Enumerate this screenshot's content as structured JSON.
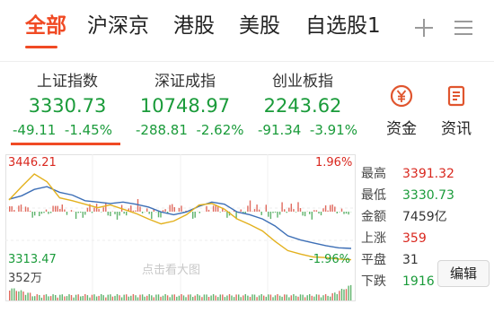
{
  "tabs": [
    {
      "label": "全部",
      "active": true
    },
    {
      "label": "沪深京",
      "active": false
    },
    {
      "label": "港股",
      "active": false
    },
    {
      "label": "美股",
      "active": false
    },
    {
      "label": "自选股1",
      "active": false
    }
  ],
  "toolbar": {
    "add_icon": "plus-icon",
    "menu_icon": "menu-icon"
  },
  "indices": [
    {
      "name": "上证指数",
      "value": "3330.73",
      "change": "-49.11",
      "pct": "-1.45%"
    },
    {
      "name": "深证成指",
      "value": "10748.97",
      "change": "-288.81",
      "pct": "-2.62%"
    },
    {
      "name": "创业板指",
      "value": "2243.62",
      "change": "-91.34",
      "pct": "-3.91%"
    }
  ],
  "side_buttons": [
    {
      "label": "资金",
      "icon": "yen-icon"
    },
    {
      "label": "资讯",
      "icon": "news-icon"
    }
  ],
  "chart": {
    "high_label": "3446.21",
    "low_label": "3313.47",
    "high_pct": "1.96%",
    "low_pct": "-1.96%",
    "volume_label": "352万",
    "watermark": "点击看大图"
  },
  "chart_data": {
    "type": "line",
    "ylim": [
      3313.47,
      3446.21
    ],
    "series": [
      {
        "color": "#3d6fb6",
        "values": [
          3400,
          3405,
          3414,
          3418,
          3410,
          3406,
          3398,
          3396,
          3394,
          3396,
          3393,
          3389,
          3382,
          3378,
          3382,
          3390,
          3396,
          3393,
          3382,
          3378,
          3372,
          3362,
          3348,
          3342,
          3338,
          3334,
          3331,
          3330
        ]
      },
      {
        "color": "#e3b11e",
        "values": [
          3399,
          3418,
          3436,
          3425,
          3402,
          3398,
          3393,
          3388,
          3392,
          3386,
          3380,
          3372,
          3365,
          3369,
          3378,
          3392,
          3394,
          3386,
          3372,
          3364,
          3355,
          3340,
          3327,
          3322,
          3318,
          3317,
          3315,
          3314
        ]
      }
    ]
  },
  "stats": [
    {
      "label": "最高",
      "value": "3391.32",
      "color": "#d9271e"
    },
    {
      "label": "最低",
      "value": "3330.73",
      "color": "#1a9b3a"
    },
    {
      "label": "金额",
      "value": "7459亿",
      "color": "#333333"
    },
    {
      "label": "上涨",
      "value": "359",
      "color": "#d9271e"
    },
    {
      "label": "平盘",
      "value": "31",
      "color": "#333333"
    },
    {
      "label": "下跌",
      "value": "1916",
      "color": "#1a9b3a"
    }
  ],
  "edit_label": "编辑",
  "colors": {
    "accent": "#f04a24",
    "up": "#d9271e",
    "down": "#1a9b3a"
  }
}
